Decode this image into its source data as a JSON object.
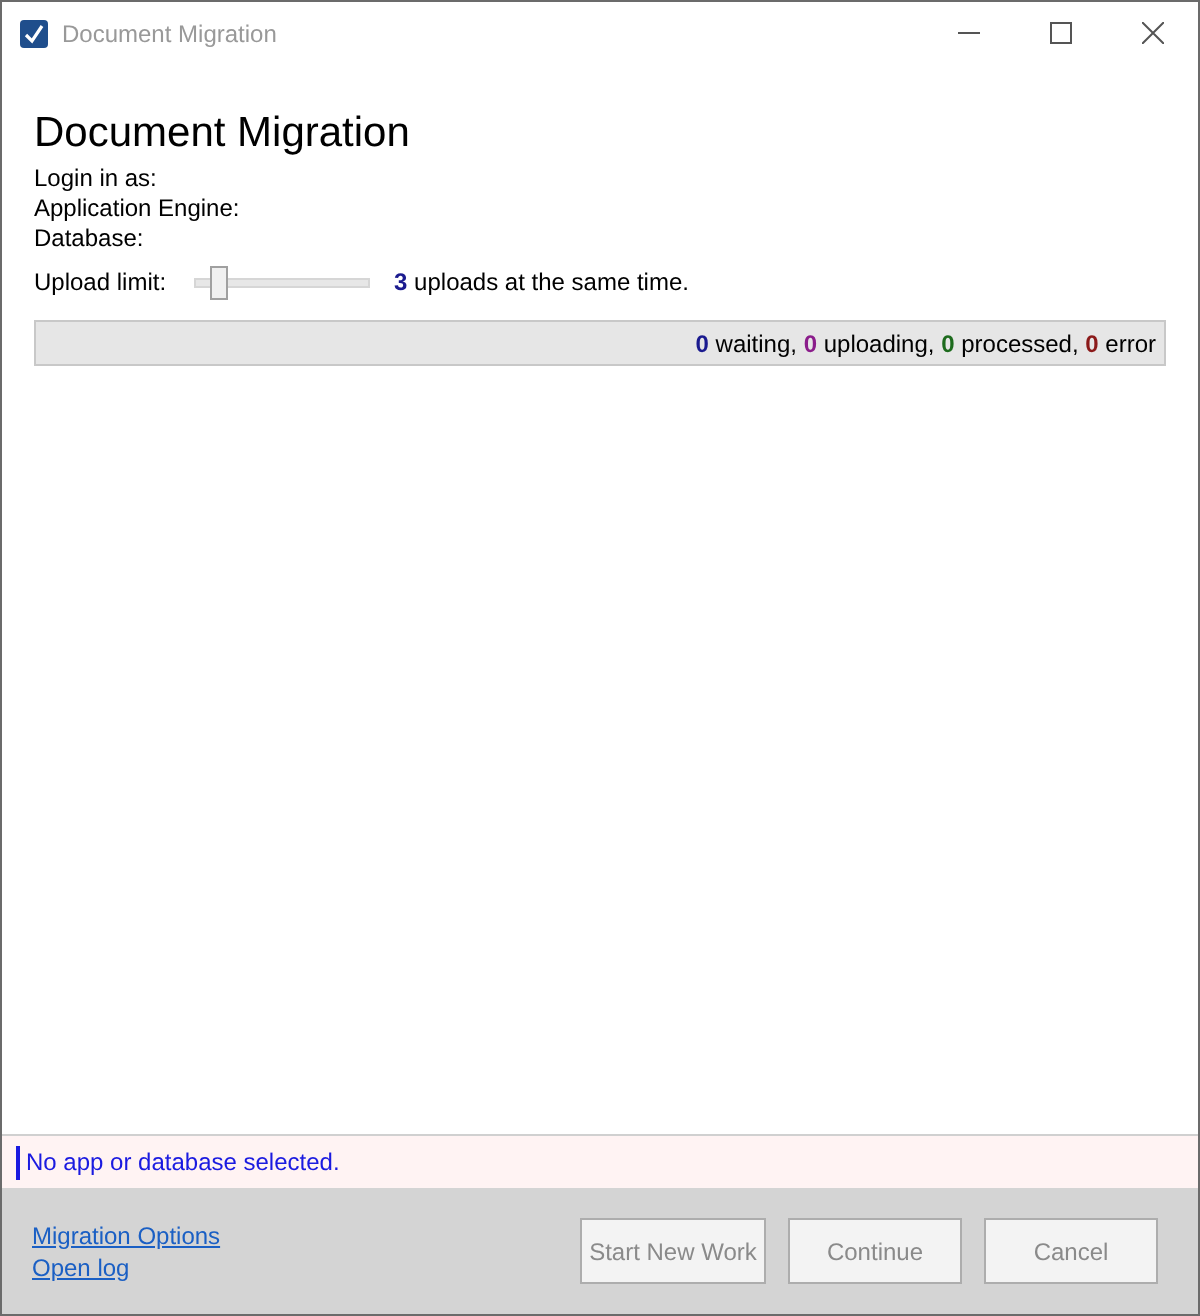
{
  "window": {
    "title": "Document Migration"
  },
  "heading": "Document Migration",
  "info_lines": [
    "Login in as:",
    "Application Engine:",
    "Database:"
  ],
  "upload_limit": {
    "label": "Upload limit:",
    "level": 0.1,
    "count": "3",
    "text": "uploads at the same time."
  },
  "status_counts": [
    {
      "count": "0",
      "label": "waiting,",
      "color": "#1b1b8f"
    },
    {
      "count": "0",
      "label": "uploading,",
      "color": "#8b1d8b"
    },
    {
      "count": "0",
      "label": "processed,",
      "color": "#1d6b1d"
    },
    {
      "count": "0",
      "label": "error",
      "color": "#8b1a1a"
    }
  ],
  "message": "No app or database selected.",
  "links": [
    "Migration Options",
    "Open log"
  ],
  "buttons": [
    {
      "label": "Start New Work",
      "disabled": true
    },
    {
      "label": "Continue",
      "disabled": true
    },
    {
      "label": "Cancel",
      "disabled": true
    }
  ]
}
